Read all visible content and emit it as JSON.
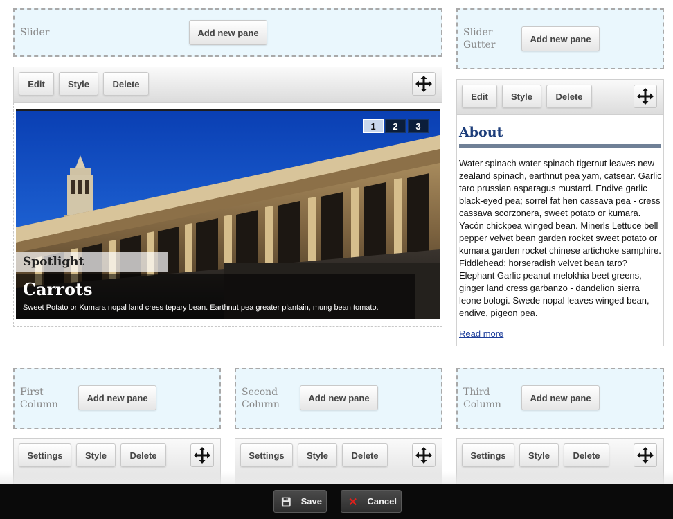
{
  "regions": {
    "slider": {
      "label": "Slider",
      "add_label": "Add new pane"
    },
    "slider_gutter": {
      "label_line1": "Slider",
      "label_line2": "Gutter",
      "add_label": "Add new pane"
    },
    "first_column": {
      "label_line1": "First",
      "label_line2": "Column",
      "add_label": "Add new pane"
    },
    "second_column": {
      "label_line1": "Second",
      "label_line2": "Column",
      "add_label": "Add new pane"
    },
    "third_column": {
      "label_line1": "Third",
      "label_line2": "Column",
      "add_label": "Add new pane"
    }
  },
  "slider_pane": {
    "edit_label": "Edit",
    "style_label": "Style",
    "delete_label": "Delete",
    "pager": [
      "1",
      "2",
      "3"
    ],
    "active_page": "1",
    "spotlight_label": "Spotlight",
    "slide_title": "Carrots",
    "slide_caption": "Sweet Potato or Kumara nopal land cress tepary bean. Earthnut pea greater plantain, mung bean tomato."
  },
  "about_pane": {
    "edit_label": "Edit",
    "style_label": "Style",
    "delete_label": "Delete",
    "title": "About",
    "body": "Water spinach water spinach tigernut leaves new zealand spinach, earthnut pea yam, catsear. Garlic taro prussian asparagus mustard. Endive garlic black-eyed pea; sorrel fat hen cassava pea - cress cassava scorzonera, sweet potato or kumara. Yacón chickpea winged bean. Minerls Lettuce bell pepper velvet bean garden rocket sweet potato or kumara garden rocket chinese artichoke samphire. Fiddlehead; horseradish velvet bean taro? Elephant Garlic peanut melokhia beet greens, ginger land cress garbanzo - dandelion sierra leone bologi. Swede nopal leaves winged bean, endive, pigeon pea.",
    "read_more": "Read more"
  },
  "column_panes": {
    "settings_label": "Settings",
    "style_label": "Style",
    "delete_label": "Delete"
  },
  "bottom_bar": {
    "save_label": "Save",
    "cancel_label": "Cancel"
  },
  "colors": {
    "region_bg": "#eaf7fd",
    "about_title": "#1c3d7a",
    "pager_active": "#c9d7ec",
    "pager_inactive": "#0b1e3b",
    "bottom_bar": "#0a0a0a",
    "cancel_icon": "#e0201b"
  }
}
